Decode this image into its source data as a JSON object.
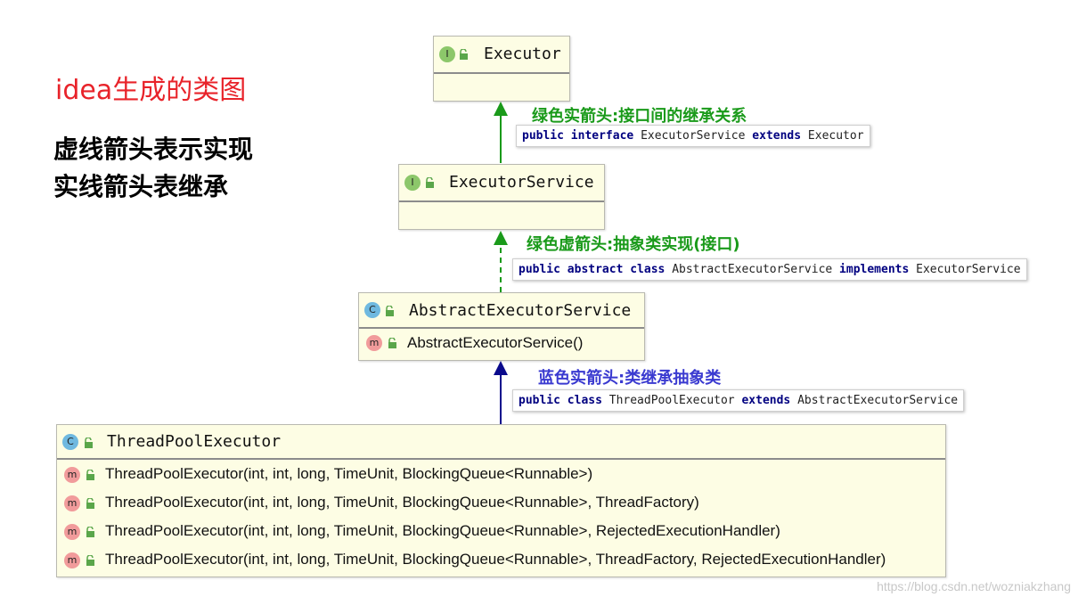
{
  "notes": {
    "title": "idea生成的类图",
    "line1": "虚线箭头表示实现",
    "line2": "实线箭头表继承"
  },
  "classes": {
    "executor": {
      "badge": "I",
      "name": "Executor"
    },
    "executor_service": {
      "badge": "I",
      "name": "ExecutorService"
    },
    "abstract_executor_service": {
      "badge": "C",
      "name": "AbstractExecutorService",
      "methods": [
        {
          "badge": "m",
          "sig": "AbstractExecutorService()"
        }
      ]
    },
    "thread_pool_executor": {
      "badge": "C",
      "name": "ThreadPoolExecutor",
      "methods": [
        {
          "badge": "m",
          "sig": "ThreadPoolExecutor(int, int, long, TimeUnit, BlockingQueue<Runnable>)"
        },
        {
          "badge": "m",
          "sig": "ThreadPoolExecutor(int, int, long, TimeUnit, BlockingQueue<Runnable>, ThreadFactory)"
        },
        {
          "badge": "m",
          "sig": "ThreadPoolExecutor(int, int, long, TimeUnit, BlockingQueue<Runnable>, RejectedExecutionHandler)"
        },
        {
          "badge": "m",
          "sig": "ThreadPoolExecutor(int, int, long, TimeUnit, BlockingQueue<Runnable>, ThreadFactory, RejectedExecutionHandler)"
        }
      ]
    }
  },
  "annotations": {
    "a1": {
      "label": "绿色实箭头:接口间的继承关系",
      "color": "#1a9a1a"
    },
    "a2": {
      "label": "绿色虚箭头:抽象类实现(接口)",
      "color": "#1a9a1a"
    },
    "a3": {
      "label": "蓝色实箭头:类继承抽象类",
      "color": "#3a3ad0"
    }
  },
  "code": {
    "c1": {
      "kw1": "public interface",
      "t1": "ExecutorService",
      "kw2": "extends",
      "t2": "Executor"
    },
    "c2": {
      "kw1": "public abstract class",
      "t1": "AbstractExecutorService",
      "kw2": "implements",
      "t2": "ExecutorService"
    },
    "c3": {
      "kw1": "public class",
      "t1": "ThreadPoolExecutor",
      "kw2": "extends",
      "t2": "AbstractExecutorService"
    }
  },
  "colors": {
    "green_arrow": "#1a9a1a",
    "blue_arrow": "#0a0a8c"
  },
  "watermark": "https://blog.csdn.net/wozniakzhang"
}
